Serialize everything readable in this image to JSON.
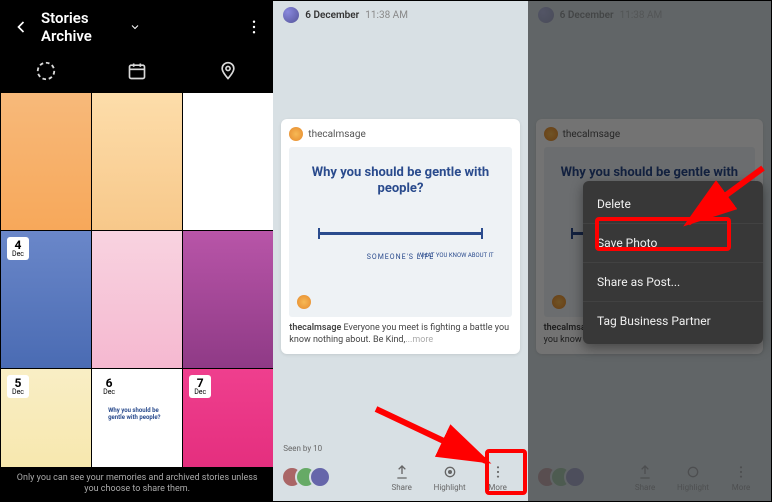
{
  "panel1": {
    "title": "Stories Archive",
    "footer": "Only you can see your memories and archived stories unless you choose to share them.",
    "tiles": [
      {
        "day": "",
        "month": ""
      },
      {
        "day": "",
        "month": ""
      },
      {
        "day": "",
        "month": ""
      },
      {
        "day": "4",
        "month": "Dec"
      },
      {
        "day": "",
        "month": ""
      },
      {
        "day": "",
        "month": ""
      },
      {
        "day": "5",
        "month": "Dec"
      },
      {
        "day": "6",
        "month": "Dec"
      },
      {
        "day": "7",
        "month": "Dec"
      }
    ],
    "tile_text": {
      "3": "",
      "7": "Why you should be gentle with people?"
    }
  },
  "panel2": {
    "date": "6 December",
    "time": "11:38 AM",
    "card_user": "thecalmsage",
    "headline": "Why you should be gentle with people?",
    "sub1": "WHAT YOU KNOW ABOUT IT",
    "sub2": "SOMEONE'S LIFE",
    "caption_user": "thecalmsage",
    "caption_text": " Everyone you meet is fighting a battle you know nothing about. Be Kind,",
    "caption_more": "...more",
    "seen_label": "Seen by 10",
    "actions": {
      "share": "Share",
      "highlight": "Highlight",
      "more": "More"
    }
  },
  "panel3": {
    "menu": {
      "delete": "Delete",
      "save": "Save Photo",
      "share_post": "Share as Post...",
      "tag": "Tag Business Partner"
    }
  }
}
